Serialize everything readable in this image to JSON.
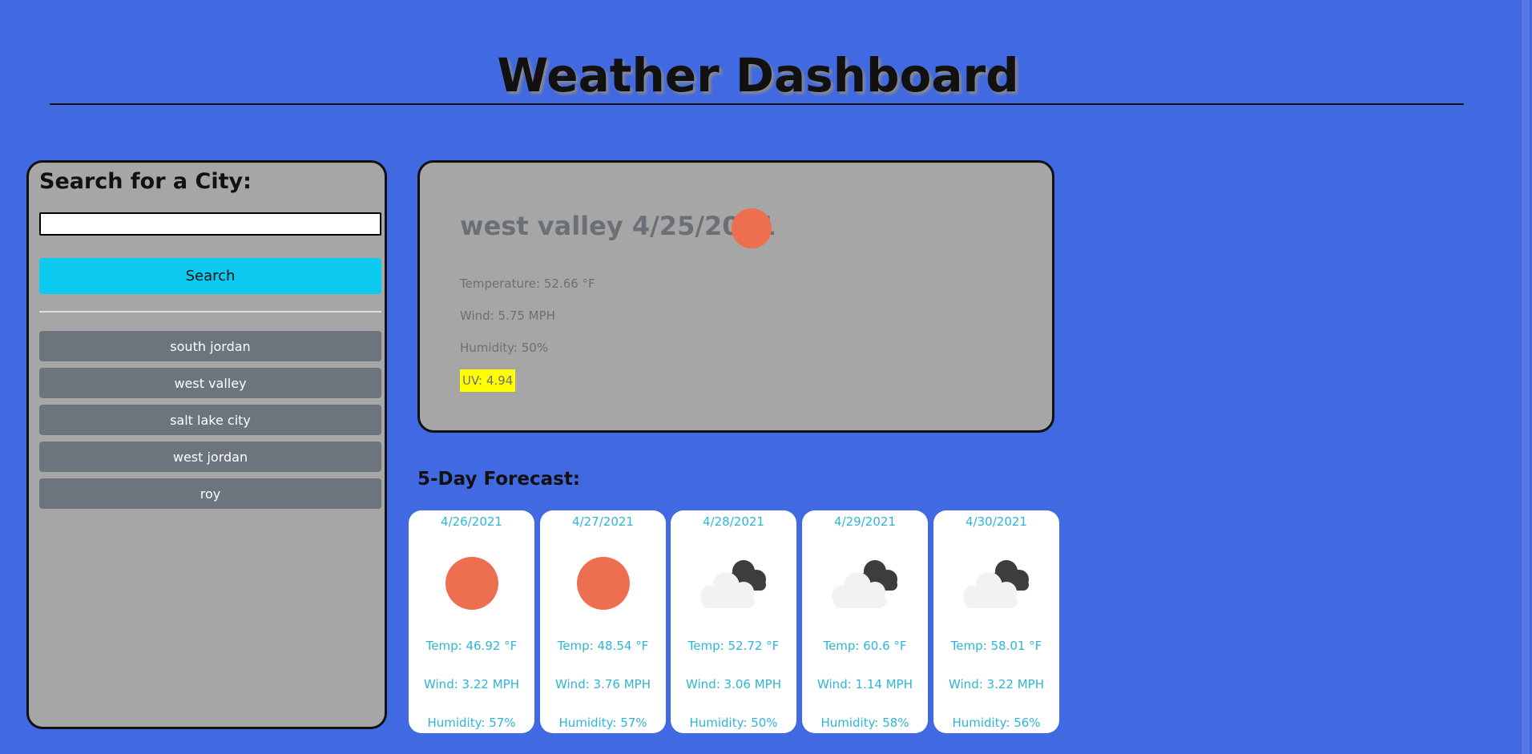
{
  "header": {
    "title": "Weather Dashboard"
  },
  "sidebar": {
    "title": "Search for a City:",
    "search_value": "",
    "search_button_label": "Search",
    "history": [
      "south jordan",
      "west valley",
      "salt lake city",
      "west jordan",
      "roy"
    ]
  },
  "current": {
    "heading": "west valley 4/25/2021",
    "icon": "sun-icon",
    "temperature": "Temperature: 52.66 °F",
    "wind": "Wind: 5.75 MPH",
    "humidity": "Humidity: 50%",
    "uv": "UV: 4.94",
    "uv_color": "#ffff00"
  },
  "forecast": {
    "title": "5-Day Forecast:",
    "days": [
      {
        "date": "4/26/2021",
        "icon": "sun-icon",
        "temp": "Temp: 46.92 °F",
        "wind": "Wind: 3.22 MPH",
        "humidity": "Humidity: 57%"
      },
      {
        "date": "4/27/2021",
        "icon": "sun-icon",
        "temp": "Temp: 48.54 °F",
        "wind": "Wind: 3.76 MPH",
        "humidity": "Humidity: 57%"
      },
      {
        "date": "4/28/2021",
        "icon": "cloud-icon",
        "temp": "Temp: 52.72 °F",
        "wind": "Wind: 3.06 MPH",
        "humidity": "Humidity: 50%"
      },
      {
        "date": "4/29/2021",
        "icon": "cloud-icon",
        "temp": "Temp: 60.6 °F",
        "wind": "Wind: 1.14 MPH",
        "humidity": "Humidity: 58%"
      },
      {
        "date": "4/30/2021",
        "icon": "cloud-icon",
        "temp": "Temp: 58.01 °F",
        "wind": "Wind: 3.22 MPH",
        "humidity": "Humidity: 56%"
      }
    ]
  },
  "colors": {
    "background": "#4169e1",
    "panel": "#a6a6a6",
    "search_button": "#0dcaf0",
    "history_button": "#6c757d",
    "forecast_text": "#2fb5d6",
    "sun": "#ee6f4f"
  }
}
